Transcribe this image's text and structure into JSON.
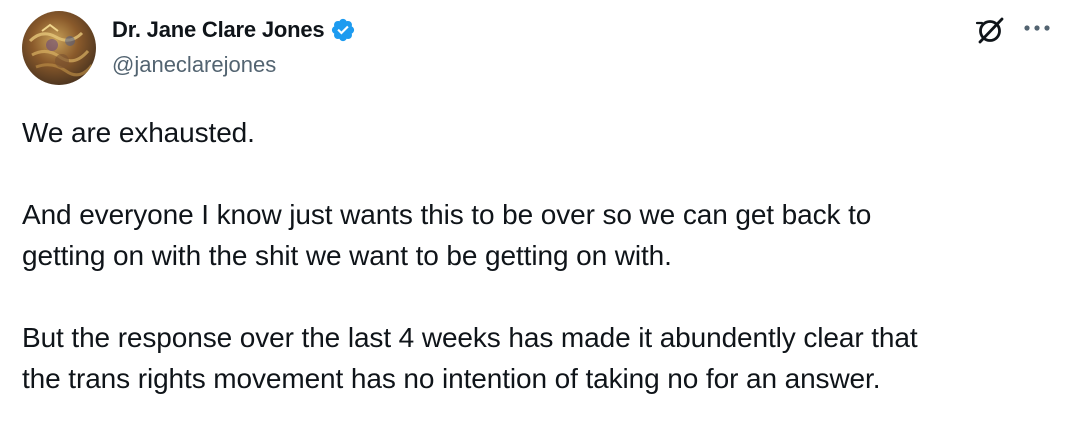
{
  "author": {
    "display_name": "Dr. Jane Clare Jones",
    "handle": "@janeclarejones",
    "verified": true,
    "verified_color": "#1d9bf0",
    "avatar_icon": "avatar-image"
  },
  "actions": {
    "grok_icon": "grok-icon",
    "more_icon": "more-options-icon"
  },
  "tweet": {
    "paragraphs": [
      "We are exhausted.",
      "And everyone I know just wants this to be over so we can get back to\ngetting on with the shit we want to be getting on with.",
      "But the response over the last 4 weeks has made it abundently clear that\nthe trans rights movement has no intention of taking no for an answer."
    ]
  },
  "colors": {
    "text": "#0f1419",
    "secondary": "#536471",
    "background": "#ffffff"
  }
}
